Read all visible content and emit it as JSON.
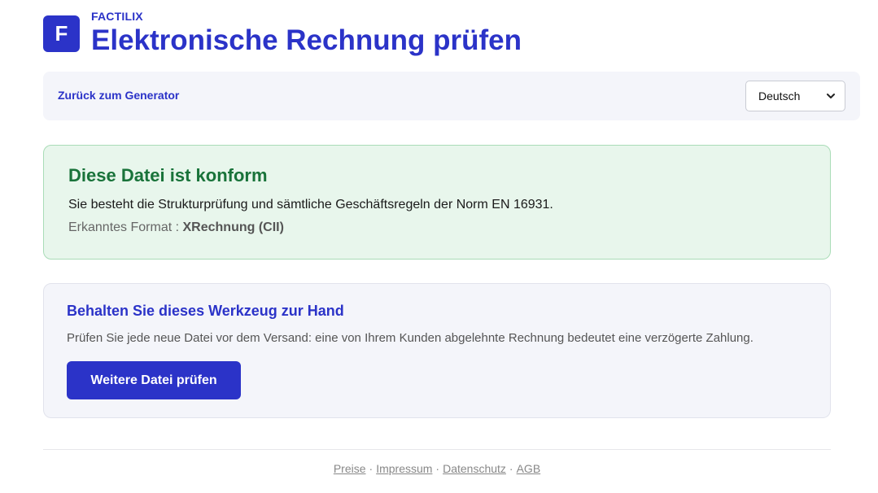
{
  "header": {
    "logo_letter": "F",
    "brand": "FACTILIX",
    "title": "Elektronische Rechnung prüfen"
  },
  "nav": {
    "back_link": "Zurück zum Generator",
    "language": {
      "selected": "Deutsch"
    }
  },
  "result": {
    "title": "Diese Datei ist konform",
    "message": "Sie besteht die Strukturprüfung und sämtliche Geschäftsregeln der Norm EN 16931.",
    "format_label": "Erkanntes Format : ",
    "format_value": "XRechnung (CII)"
  },
  "promo": {
    "title": "Behalten Sie dieses Werkzeug zur Hand",
    "text": "Prüfen Sie jede neue Datei vor dem Versand: eine von Ihrem Kunden abgelehnte Rechnung bedeutet eine verzögerte Zahlung.",
    "button": "Weitere Datei prüfen"
  },
  "footer": {
    "links": [
      "Preise",
      "Impressum",
      "Datenschutz",
      "AGB"
    ],
    "separator": "·"
  },
  "colors": {
    "accent": "#2b33c8",
    "success_text": "#19733a",
    "success_bg": "#e8f6ec",
    "success_border": "#a9dcb7"
  }
}
